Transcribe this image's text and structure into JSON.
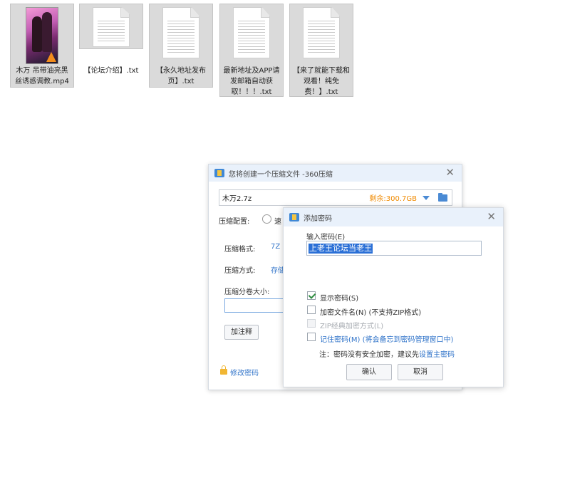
{
  "files": [
    {
      "name": "木万 吊带油亮黑丝诱惑调教.mp4",
      "type": "video"
    },
    {
      "name": "【论坛介绍】.txt",
      "type": "text"
    },
    {
      "name": "【永久地址发布页】.txt",
      "type": "text"
    },
    {
      "name": "最新地址及APP请发邮箱自动获取！！！.txt",
      "type": "text"
    },
    {
      "name": "【来了就能下载和观看！纯免费！】.txt",
      "type": "text"
    }
  ],
  "main_window": {
    "title": "您将创建一个压缩文件 -360压缩",
    "archive_name": "木万2.7z",
    "free_space": "剩余:300.7GB",
    "config_label": "压缩配置:",
    "config_option_partial": "速",
    "format_label": "压缩格式:",
    "format_value": "7Z",
    "method_label": "压缩方式:",
    "method_value_partial": "存储",
    "volume_label": "压缩分卷大小:",
    "comment_button": "加注释",
    "change_password_link": "修改密码"
  },
  "password_dialog": {
    "title": "添加密码",
    "input_label": "输入密码(E)",
    "password_value": "上老王论坛当老王",
    "show_password": {
      "label": "显示密码(S)",
      "checked": true
    },
    "encrypt_filenames": {
      "label": "加密文件名(N) (不支持ZIP格式)",
      "checked": false
    },
    "zip_classic": {
      "label": "ZIP经典加密方式(L)",
      "checked": false,
      "disabled": true
    },
    "remember_password": {
      "label": "记住密码(M) (将会备忘到密码管理窗口中)",
      "checked": false
    },
    "note_prefix": "注：密码没有安全加密，建议先",
    "note_link": "设置主密码",
    "ok_button": "确认",
    "cancel_button": "取消"
  },
  "colors": {
    "accent": "#2f73c9",
    "free_space": "#f08a00",
    "selection": "#2a6fd6"
  }
}
